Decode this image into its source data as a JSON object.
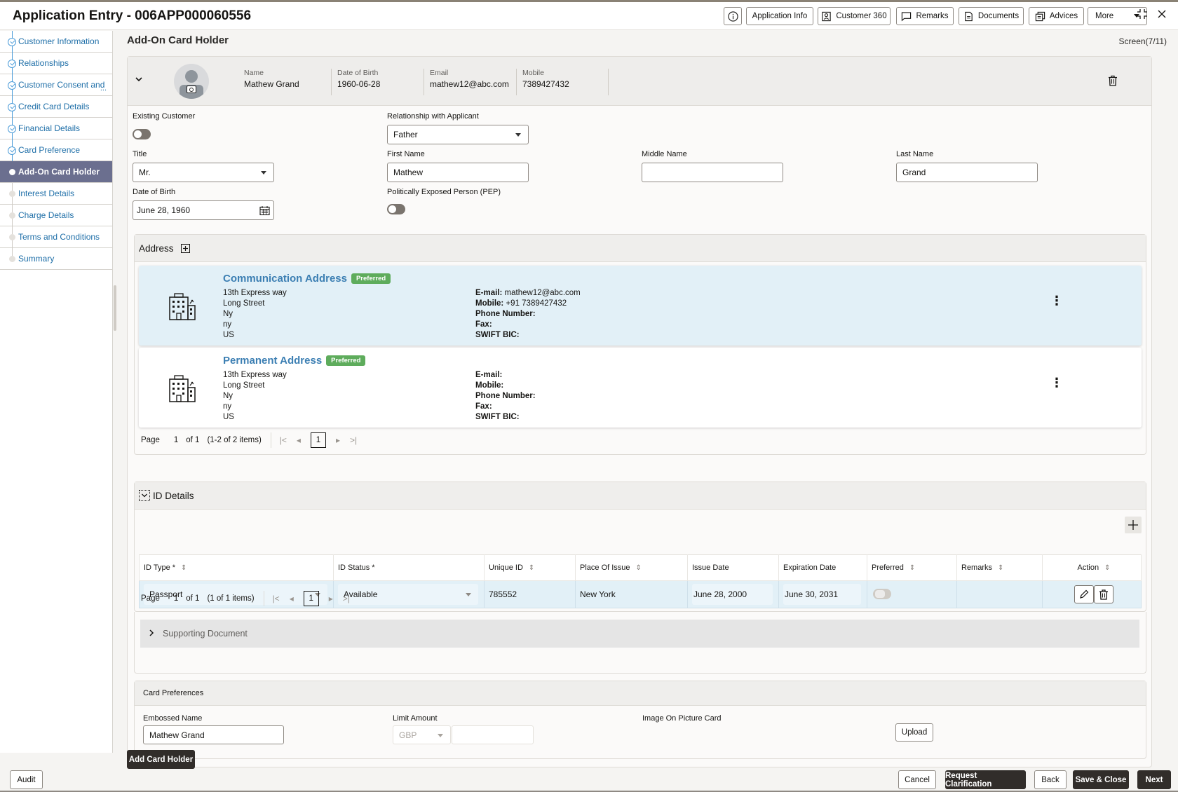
{
  "header": {
    "title": "Application Entry - 006APP000060556",
    "buttons": {
      "info_icon": "info-icon",
      "application_info": "Application Info",
      "customer_360": "Customer 360",
      "remarks": "Remarks",
      "documents": "Documents",
      "advices": "Advices",
      "more": "More"
    }
  },
  "sidebar": {
    "items": [
      {
        "label": "Customer Information",
        "state": "done"
      },
      {
        "label": "Relationships",
        "state": "done"
      },
      {
        "label": "Customer Consent and",
        "state": "done"
      },
      {
        "label": "Credit Card Details",
        "state": "done"
      },
      {
        "label": "Financial Details",
        "state": "done"
      },
      {
        "label": "Card Preference",
        "state": "done"
      },
      {
        "label": "Add-On Card Holder",
        "state": "active"
      },
      {
        "label": "Interest Details",
        "state": "pending"
      },
      {
        "label": "Charge Details",
        "state": "pending"
      },
      {
        "label": "Terms and Conditions",
        "state": "pending"
      },
      {
        "label": "Summary",
        "state": "pending"
      }
    ],
    "truncation": "..."
  },
  "page": {
    "title": "Add-On Card Holder",
    "screen": "Screen(7/11)"
  },
  "profile": {
    "name_label": "Name",
    "name": "Mathew Grand",
    "dob_label": "Date of Birth",
    "dob": "1960-06-28",
    "email_label": "Email",
    "email": "mathew12@abc.com",
    "mobile_label": "Mobile",
    "mobile": "7389427432"
  },
  "form": {
    "existing_customer_label": "Existing Customer",
    "existing_customer": false,
    "relationship_label": "Relationship with Applicant",
    "relationship": "Father",
    "title_label": "Title",
    "title": "Mr.",
    "first_name_label": "First Name",
    "first_name": "Mathew",
    "middle_name_label": "Middle Name",
    "middle_name": "",
    "last_name_label": "Last Name",
    "last_name": "Grand",
    "dob_label": "Date of Birth",
    "dob": "June 28, 1960",
    "pep_label": "Politically Exposed Person (PEP)",
    "pep": false
  },
  "address": {
    "section_title": "Address",
    "cards": [
      {
        "title": "Communication Address",
        "badge": "Preferred",
        "lines": [
          "13th Express way",
          "Long Street",
          "Ny",
          "ny",
          "US"
        ],
        "email_label": "E-mail:",
        "email": "mathew12@abc.com",
        "mobile_label": "Mobile:",
        "mobile": "+91 7389427432",
        "phone_label": "Phone Number:",
        "phone": "",
        "fax_label": "Fax:",
        "fax": "",
        "swift_label": "SWIFT BIC:",
        "swift": ""
      },
      {
        "title": "Permanent Address",
        "badge": "Preferred",
        "lines": [
          "13th Express way",
          "Long Street",
          "Ny",
          "ny",
          "US"
        ],
        "email_label": "E-mail:",
        "email": "",
        "mobile_label": "Mobile:",
        "mobile": "",
        "phone_label": "Phone Number:",
        "phone": "",
        "fax_label": "Fax:",
        "fax": "",
        "swift_label": "SWIFT BIC:",
        "swift": ""
      }
    ],
    "pager": {
      "page_label": "Page",
      "page": "1",
      "of": "of 1",
      "items": "(1-2 of 2 items)",
      "current": "1"
    }
  },
  "id_details": {
    "section_title": "ID Details",
    "columns": [
      "ID Type *",
      "ID Status *",
      "Unique ID",
      "Place Of Issue",
      "Issue Date",
      "Expiration Date",
      "Preferred",
      "Remarks",
      "Action"
    ],
    "rows": [
      {
        "id_type": "Passport",
        "id_status": "Available",
        "unique_id": "785552",
        "place_of_issue": "New York",
        "issue_date": "June 28, 2000",
        "expiration_date": "June 30, 2031",
        "preferred": false,
        "remarks": ""
      }
    ],
    "pager": {
      "page_label": "Page",
      "page": "1",
      "of": "of 1",
      "items": "(1 of 1 items)",
      "current": "1"
    }
  },
  "supporting_document": {
    "title": "Supporting Document"
  },
  "card_preferences": {
    "title": "Card Preferences",
    "embossed_name_label": "Embossed Name",
    "embossed_name": "Mathew Grand",
    "limit_amount_label": "Limit Amount",
    "currency": "GBP",
    "limit_amount": "",
    "image_label": "Image On Picture Card",
    "upload": "Upload"
  },
  "actions": {
    "add_card_holder": "Add Card Holder",
    "audit": "Audit",
    "cancel": "Cancel",
    "request_clarification": "Request Clarification",
    "back": "Back",
    "save_close": "Save & Close",
    "next": "Next"
  }
}
